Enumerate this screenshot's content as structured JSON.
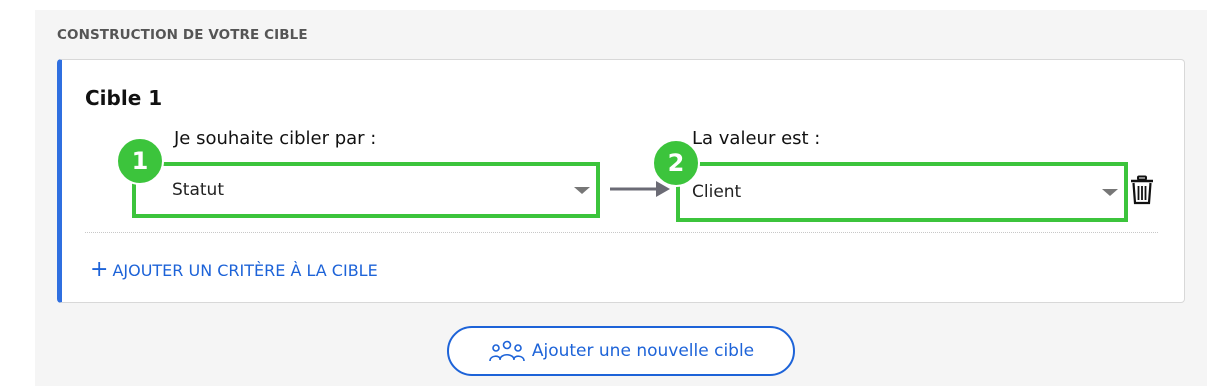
{
  "section_title": "CONSTRUCTION DE VOTRE CIBLE",
  "target": {
    "title": "Cible 1",
    "field1": {
      "label": "Je souhaite cibler par :",
      "value": "Statut",
      "step": "1"
    },
    "field2": {
      "label": "La valeur est :",
      "value": "Client",
      "step": "2"
    }
  },
  "add_criterion": {
    "plus": "+",
    "label": "AJOUTER UN CRITÈRE À LA CIBLE"
  },
  "add_target_label": "Ajouter une nouvelle cible",
  "icons": {
    "arrow": "arrow-right-icon",
    "trash": "trash-icon",
    "group": "group-icon",
    "caret": "chevron-down-icon"
  },
  "colors": {
    "accent_blue": "#1d63d8",
    "highlight_green": "#3cc43c",
    "card_border_blue": "#2f6fe0"
  }
}
